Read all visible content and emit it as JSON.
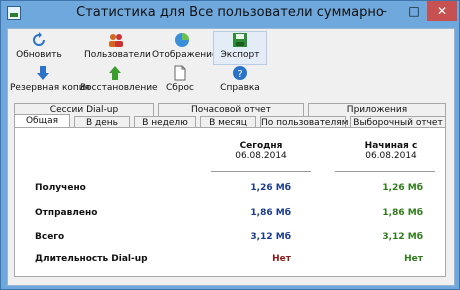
{
  "window": {
    "title": "Статистика для Все пользователи суммарно",
    "controls": {
      "minimize": "–",
      "maximize": "□",
      "close": "✕"
    }
  },
  "toolbar": {
    "refresh": "Обновить",
    "users": "Пользователи",
    "display": "Отображение",
    "export": "Экспорт",
    "backup": "Резервная копия",
    "restore": "Восстановление",
    "reset": "Сброс",
    "help": "Справка"
  },
  "tabs": {
    "row1": [
      "Сессии Dial-up",
      "Почасовой отчет",
      "Приложения"
    ],
    "row2": [
      "Общая",
      "В день",
      "В неделю",
      "В месяц",
      "По пользователям",
      "Выборочный отчет"
    ],
    "active": "Общая"
  },
  "summary": {
    "col_today": {
      "label": "Сегодня",
      "date": "06.08.2014"
    },
    "col_since": {
      "label": "Начиная с",
      "date": "06.08.2014"
    },
    "rows": [
      {
        "label": "Получено",
        "today": "1,26 Мб",
        "since": "1,26 Мб"
      },
      {
        "label": "Отправлено",
        "today": "1,86 Мб",
        "since": "1,86 Мб"
      },
      {
        "label": "Всего",
        "today": "3,12 Мб",
        "since": "3,12 Мб"
      },
      {
        "label": "Длительность Dial-up",
        "today": "Нет",
        "since": "Нет"
      }
    ]
  },
  "colors": {
    "today": "#1a3a8f",
    "since": "#2f7d1a",
    "titlebar": "#6fa8dc",
    "close": "#c75050"
  }
}
